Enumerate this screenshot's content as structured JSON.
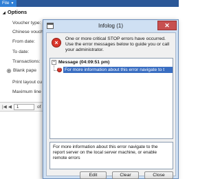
{
  "app": {
    "file_menu_label": "File"
  },
  "options_panel": {
    "heading": "Options",
    "labels": [
      "Voucher type:",
      "Chinese vouch",
      "From date:",
      "To date:",
      "Transactions:"
    ],
    "radio_label": "Blank pape",
    "labels_after": [
      "Print layout cu",
      "Maximum line"
    ]
  },
  "pager": {
    "page_value": "1",
    "of_label": "of"
  },
  "dialog": {
    "title": "Infolog (1)",
    "close_glyph": "✕",
    "summary": "One or more critical STOP errors have occurred. Use the error messages below to guide you or call your administrator.",
    "tree": {
      "root_label": "Message (04:09:51 pm)",
      "child_label": "For more information about this error navigate to t"
    },
    "detail_text": "For more information about this error navigate to the report server on the local server machine, or enable remote errors",
    "buttons": {
      "edit": "Edit",
      "clear": "Clear",
      "close": "Close"
    }
  },
  "colors": {
    "title_bar": "#cfe0f3",
    "selection": "#3a6ec2",
    "stop_red": "#d9362b",
    "close_button": "#c75050"
  }
}
